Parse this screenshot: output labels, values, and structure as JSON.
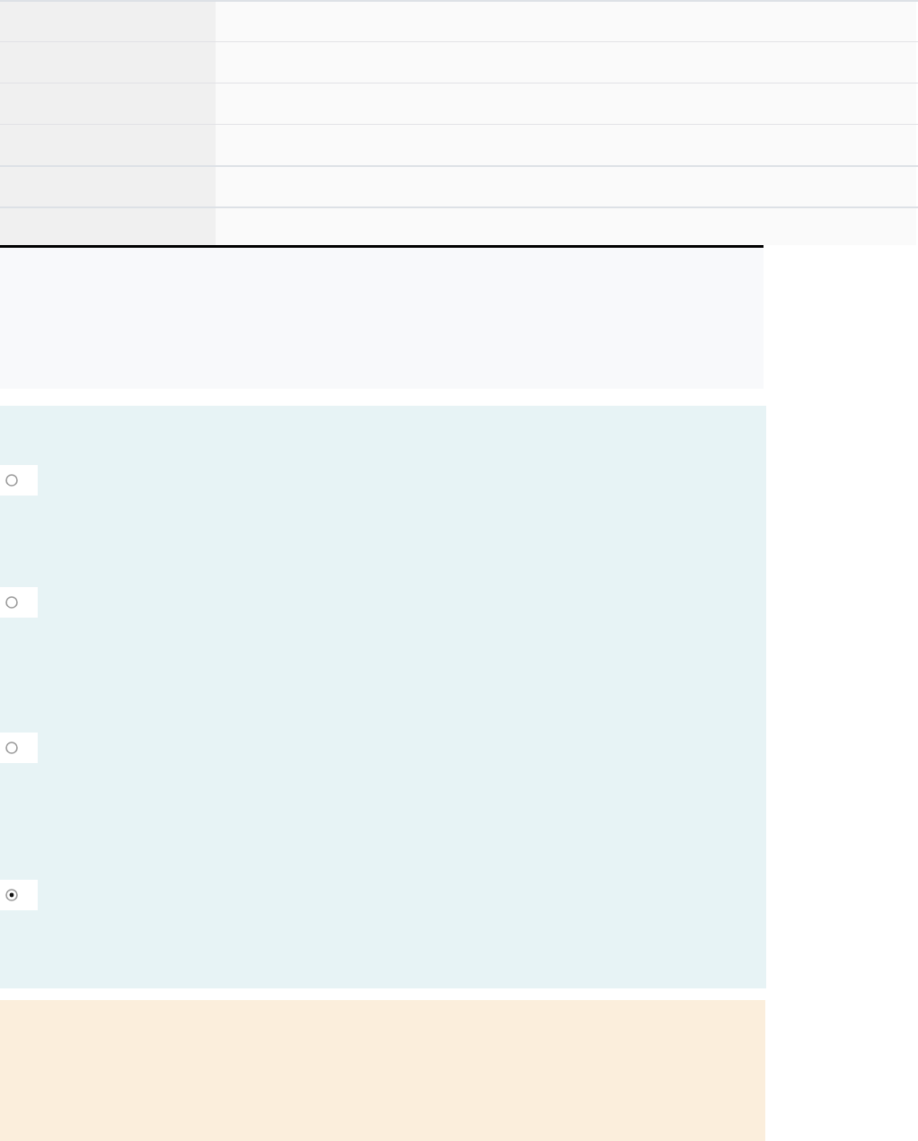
{
  "summary_table": {
    "rows": [
      {
        "kind": "field"
      },
      {
        "kind": "field"
      },
      {
        "kind": "field"
      },
      {
        "kind": "field"
      },
      {
        "kind": "field"
      },
      {
        "kind": "field"
      }
    ]
  },
  "answer": {
    "options": [
      {
        "selected": false
      },
      {
        "selected": false
      },
      {
        "selected": false
      },
      {
        "selected": true
      }
    ]
  }
}
